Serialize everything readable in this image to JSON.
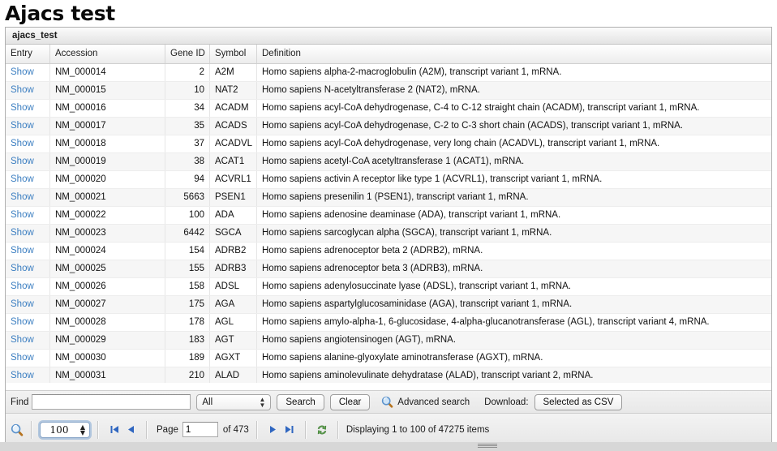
{
  "page": {
    "title": "Ajacs test"
  },
  "panel": {
    "header_title": "ajacs_test"
  },
  "table": {
    "columns": [
      "Entry",
      "Accession",
      "Gene ID",
      "Symbol",
      "Definition"
    ],
    "entry_link_label": "Show",
    "rows": [
      {
        "accession": "NM_000014",
        "gene_id": "2",
        "symbol": "A2M",
        "definition": "Homo sapiens alpha-2-macroglobulin (A2M), transcript variant 1, mRNA."
      },
      {
        "accession": "NM_000015",
        "gene_id": "10",
        "symbol": "NAT2",
        "definition": "Homo sapiens N-acetyltransferase 2 (NAT2), mRNA."
      },
      {
        "accession": "NM_000016",
        "gene_id": "34",
        "symbol": "ACADM",
        "definition": "Homo sapiens acyl-CoA dehydrogenase, C-4 to C-12 straight chain (ACADM), transcript variant 1, mRNA."
      },
      {
        "accession": "NM_000017",
        "gene_id": "35",
        "symbol": "ACADS",
        "definition": "Homo sapiens acyl-CoA dehydrogenase, C-2 to C-3 short chain (ACADS), transcript variant 1, mRNA."
      },
      {
        "accession": "NM_000018",
        "gene_id": "37",
        "symbol": "ACADVL",
        "definition": "Homo sapiens acyl-CoA dehydrogenase, very long chain (ACADVL), transcript variant 1, mRNA."
      },
      {
        "accession": "NM_000019",
        "gene_id": "38",
        "symbol": "ACAT1",
        "definition": "Homo sapiens acetyl-CoA acetyltransferase 1 (ACAT1), mRNA."
      },
      {
        "accession": "NM_000020",
        "gene_id": "94",
        "symbol": "ACVRL1",
        "definition": "Homo sapiens activin A receptor like type 1 (ACVRL1), transcript variant 1, mRNA."
      },
      {
        "accession": "NM_000021",
        "gene_id": "5663",
        "symbol": "PSEN1",
        "definition": "Homo sapiens presenilin 1 (PSEN1), transcript variant 1, mRNA."
      },
      {
        "accession": "NM_000022",
        "gene_id": "100",
        "symbol": "ADA",
        "definition": "Homo sapiens adenosine deaminase (ADA), transcript variant 1, mRNA."
      },
      {
        "accession": "NM_000023",
        "gene_id": "6442",
        "symbol": "SGCA",
        "definition": "Homo sapiens sarcoglycan alpha (SGCA), transcript variant 1, mRNA."
      },
      {
        "accession": "NM_000024",
        "gene_id": "154",
        "symbol": "ADRB2",
        "definition": "Homo sapiens adrenoceptor beta 2 (ADRB2), mRNA."
      },
      {
        "accession": "NM_000025",
        "gene_id": "155",
        "symbol": "ADRB3",
        "definition": "Homo sapiens adrenoceptor beta 3 (ADRB3), mRNA."
      },
      {
        "accession": "NM_000026",
        "gene_id": "158",
        "symbol": "ADSL",
        "definition": "Homo sapiens adenylosuccinate lyase (ADSL), transcript variant 1, mRNA."
      },
      {
        "accession": "NM_000027",
        "gene_id": "175",
        "symbol": "AGA",
        "definition": "Homo sapiens aspartylglucosaminidase (AGA), transcript variant 1, mRNA."
      },
      {
        "accession": "NM_000028",
        "gene_id": "178",
        "symbol": "AGL",
        "definition": "Homo sapiens amylo-alpha-1, 6-glucosidase, 4-alpha-glucanotransferase (AGL), transcript variant 4, mRNA."
      },
      {
        "accession": "NM_000029",
        "gene_id": "183",
        "symbol": "AGT",
        "definition": "Homo sapiens angiotensinogen (AGT), mRNA."
      },
      {
        "accession": "NM_000030",
        "gene_id": "189",
        "symbol": "AGXT",
        "definition": "Homo sapiens alanine-glyoxylate aminotransferase (AGXT), mRNA."
      },
      {
        "accession": "NM_000031",
        "gene_id": "210",
        "symbol": "ALAD",
        "definition": "Homo sapiens aminolevulinate dehydratase (ALAD), transcript variant 2, mRNA."
      }
    ]
  },
  "find_bar": {
    "find_label": "Find",
    "find_value": "",
    "find_placeholder": "",
    "scope_selected": "All",
    "scope_options": [
      "All"
    ],
    "search_label": "Search",
    "clear_label": "Clear",
    "advanced_search_label": "Advanced search",
    "download_label": "Download:",
    "csv_label": "Selected as CSV"
  },
  "pager": {
    "page_size": "100",
    "page_size_options": [
      "100"
    ],
    "page_label": "Page",
    "page_value": "1",
    "of_label": "of 473",
    "total_pages": "473",
    "status": "Displaying 1 to 100 of 47275 items"
  },
  "colors": {
    "link": "#3b7ec1",
    "magnifier": "#6ea8dc",
    "refresh": "#64a858",
    "arrow": "#2f66c0"
  }
}
